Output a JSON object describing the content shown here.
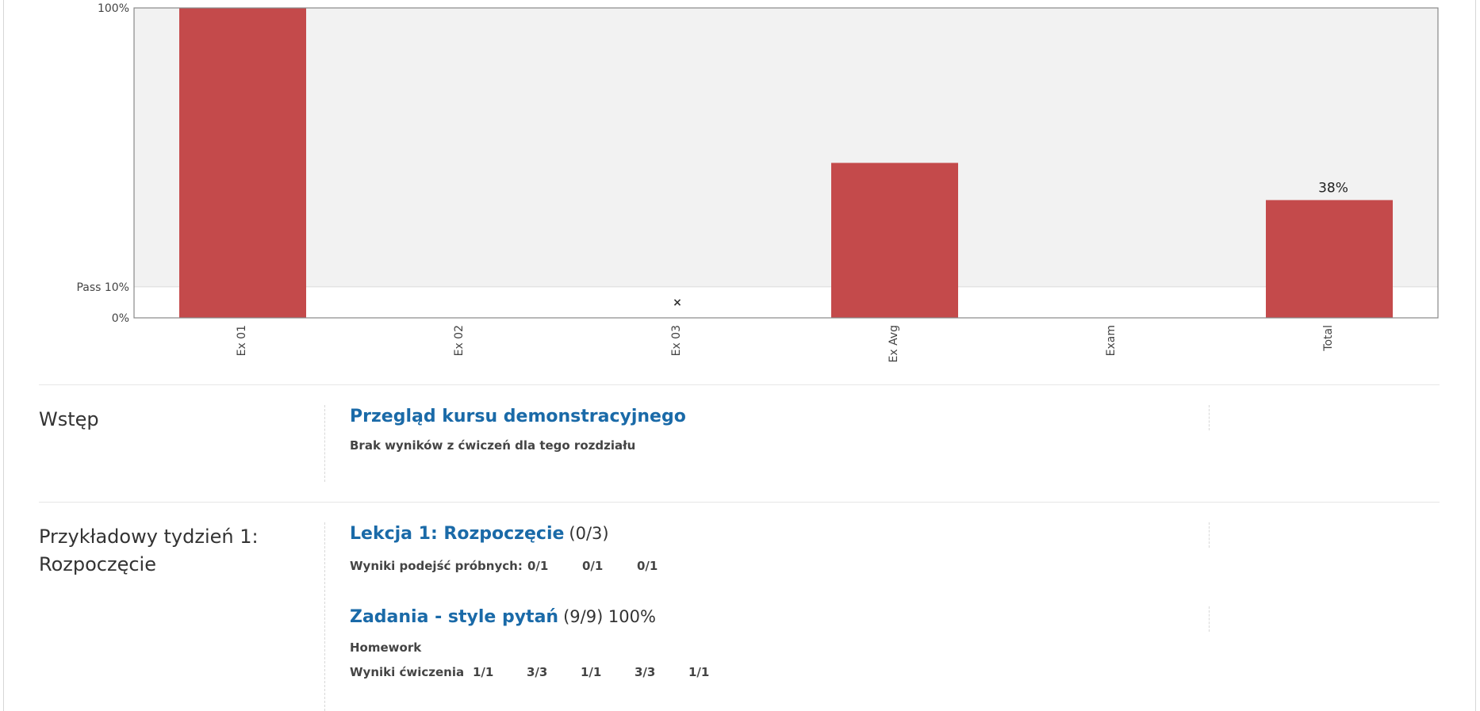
{
  "chart_data": {
    "type": "bar",
    "categories": [
      "Ex 01",
      "Ex 02",
      "Ex 03",
      "Ex Avg",
      "Exam",
      "Total"
    ],
    "values": [
      100,
      null,
      null,
      50,
      null,
      38
    ],
    "missing_marker": [
      "",
      "",
      "×",
      "",
      "",
      ""
    ],
    "data_labels": [
      "",
      "",
      "",
      "",
      "",
      "38%"
    ],
    "y_ticks": [
      {
        "value": 100,
        "label": "100%"
      },
      {
        "value": 10,
        "label": "Pass 10%"
      },
      {
        "value": 0,
        "label": "0%"
      }
    ],
    "ylim": [
      0,
      100
    ],
    "pass_threshold": 10,
    "colors": {
      "bar": "#c44a4b",
      "plot_bg": "#f2f2f2",
      "below_pass_bg": "#ffffff",
      "axis": "#888888"
    }
  },
  "sections": [
    {
      "title": "Wstęp",
      "units": [
        {
          "title": "Przegląd kursu demonstracyjnego",
          "score": "",
          "note": "Brak wyników z ćwiczeń dla tego rozdziału"
        }
      ]
    },
    {
      "title": "Przykładowy tydzień 1: Rozpoczęcie",
      "units": [
        {
          "title": "Lekcja 1: Rozpoczęcie",
          "score": "(0/3)",
          "scores_label": "Wyniki podejść próbnych:",
          "scores": [
            "0/1",
            "0/1",
            "0/1"
          ]
        },
        {
          "title": "Zadania - style pytań",
          "score": "(9/9) 100%",
          "note": "Homework",
          "scores_label": "Wyniki ćwiczenia",
          "scores": [
            "1/1",
            "3/3",
            "1/1",
            "3/3",
            "1/1"
          ]
        }
      ]
    }
  ]
}
